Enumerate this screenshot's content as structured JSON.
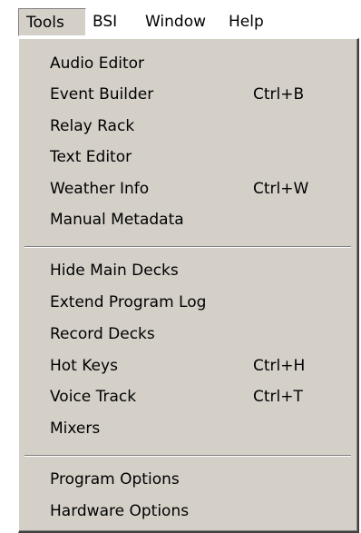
{
  "menubar": {
    "items": [
      {
        "label": "Tools"
      },
      {
        "label": "BSI"
      },
      {
        "label": "Window"
      },
      {
        "label": "Help"
      }
    ]
  },
  "tools_menu": {
    "groups": [
      [
        {
          "label": "Audio Editor",
          "shortcut": ""
        },
        {
          "label": "Event Builder",
          "shortcut": "Ctrl+B"
        },
        {
          "label": "Relay Rack",
          "shortcut": ""
        },
        {
          "label": "Text Editor",
          "shortcut": ""
        },
        {
          "label": "Weather Info",
          "shortcut": "Ctrl+W"
        },
        {
          "label": "Manual Metadata",
          "shortcut": ""
        }
      ],
      [
        {
          "label": "Hide Main Decks",
          "shortcut": ""
        },
        {
          "label": "Extend Program Log",
          "shortcut": ""
        },
        {
          "label": "Record Decks",
          "shortcut": ""
        },
        {
          "label": "Hot Keys",
          "shortcut": "Ctrl+H"
        },
        {
          "label": "Voice Track",
          "shortcut": "Ctrl+T"
        },
        {
          "label": "Mixers",
          "shortcut": ""
        }
      ],
      [
        {
          "label": "Program Options",
          "shortcut": ""
        },
        {
          "label": "Hardware Options",
          "shortcut": ""
        }
      ]
    ]
  },
  "colors": {
    "menu_background": "#d4d0c8",
    "text": "#000000",
    "separator_shadow": "#808080",
    "separator_highlight": "#ffffff"
  }
}
